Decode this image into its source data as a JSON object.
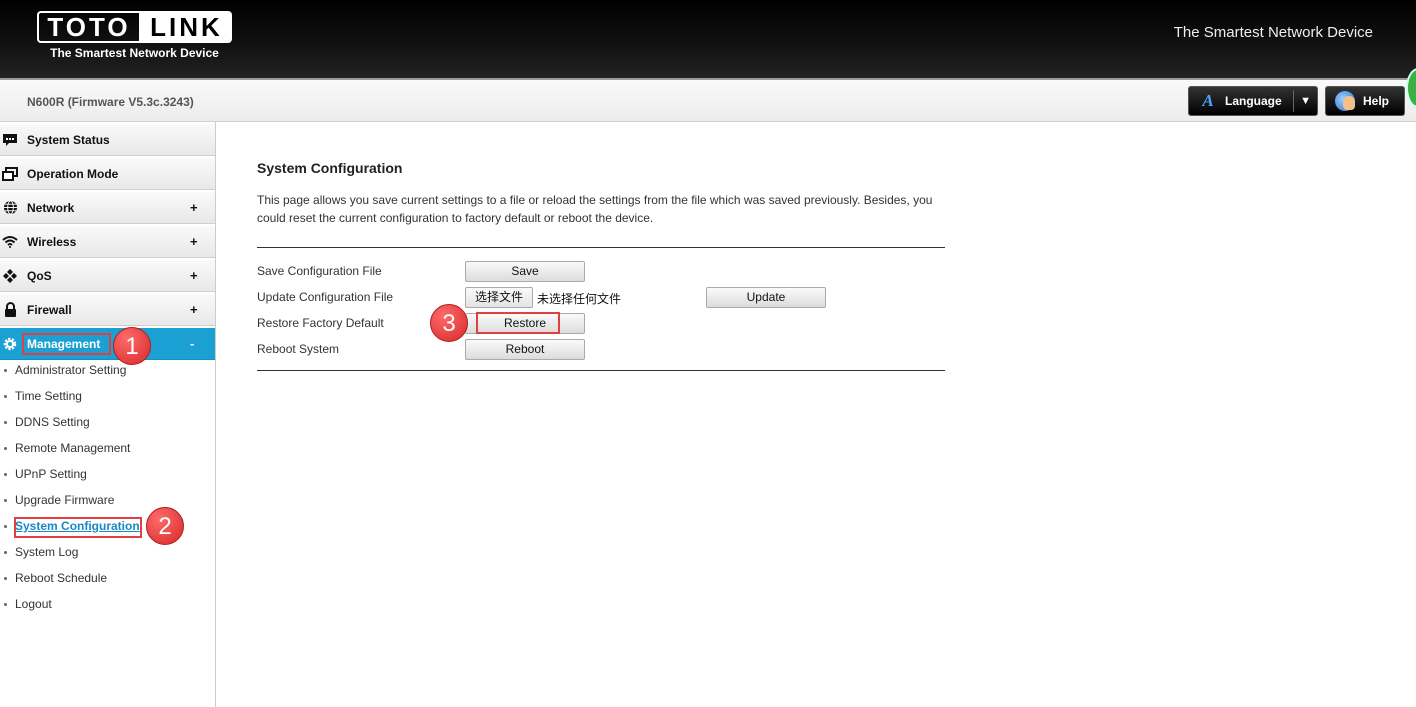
{
  "header": {
    "logo_left": "TOTO",
    "logo_right": "LINK",
    "logo_sub": "The Smartest Network Device",
    "tagline": "The Smartest Network Device"
  },
  "subbar": {
    "model": "N600R (Firmware V5.3c.3243)",
    "language_label": "Language",
    "help_label": "Help"
  },
  "sidebar": {
    "items": [
      {
        "label": "System Status",
        "icon": "chat-bubble-icon",
        "expander": ""
      },
      {
        "label": "Operation Mode",
        "icon": "windows-icon",
        "expander": ""
      },
      {
        "label": "Network",
        "icon": "globe-icon",
        "expander": "+"
      },
      {
        "label": "Wireless",
        "icon": "wifi-icon",
        "expander": "+"
      },
      {
        "label": "QoS",
        "icon": "qos-icon",
        "expander": "+"
      },
      {
        "label": "Firewall",
        "icon": "lock-icon",
        "expander": "+"
      },
      {
        "label": "Management",
        "icon": "gear-icon",
        "expander": "-"
      }
    ],
    "subitems": [
      "Administrator Setting",
      "Time Setting",
      "DDNS Setting",
      "Remote Management",
      "UPnP Setting",
      "Upgrade Firmware",
      "System Configuration",
      "System Log",
      "Reboot Schedule",
      "Logout"
    ],
    "active_color": "#1aa0d2"
  },
  "steps": [
    "1",
    "2",
    "3"
  ],
  "main": {
    "title": "System Configuration",
    "description": "This page allows you save current settings to a file or reload the settings from the file which was saved previously. Besides, you could reset the current configuration to factory default or reboot the device.",
    "rows": {
      "save_label": "Save Configuration File",
      "save_button": "Save",
      "update_label": "Update Configuration File",
      "choose_file_button": "选择文件",
      "no_file_text": "未选择任何文件",
      "update_button": "Update",
      "restore_label": "Restore Factory Default",
      "restore_button": "Restore",
      "reboot_label": "Reboot System",
      "reboot_button": "Reboot"
    }
  },
  "colors": {
    "highlight": "#e04040",
    "step_badge": "#d62a2a",
    "link": "#1a88c4"
  }
}
